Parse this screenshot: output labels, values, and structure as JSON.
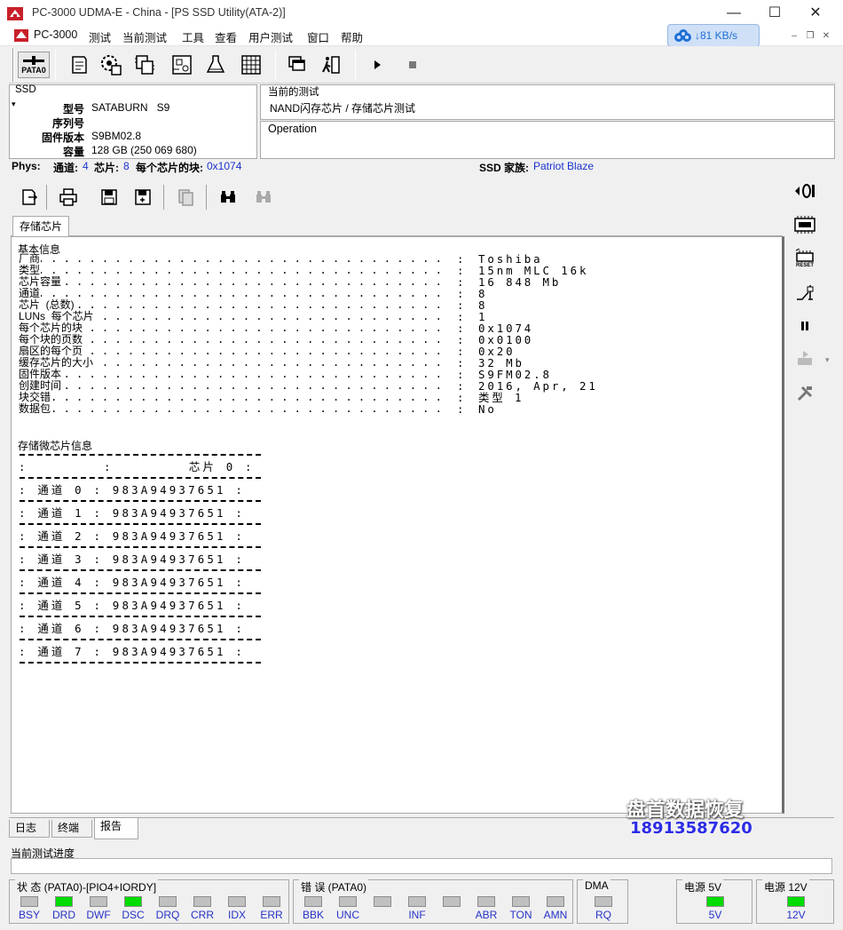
{
  "window": {
    "title": "PC-3000 UDMA-E - China - [PS SSD Utility(ATA-2)]"
  },
  "menu": [
    "PC-3000",
    "测试",
    "当前测试",
    "工具",
    "查看",
    "用户测试",
    "窗口",
    "帮助"
  ],
  "net_speed": "↓81 KB/s",
  "toolbar": {
    "pata_label": "PATA0"
  },
  "ssd_panel": {
    "title": "SSD",
    "model_label": "型号",
    "model_value": "SATABURN   S9",
    "serial_label": "序列号",
    "serial_value": "",
    "firmware_label": "固件版本",
    "firmware_value": "S9BM02.8",
    "capacity_label": "容量",
    "capacity_value": "128 GB (250 069 680)"
  },
  "current_test": {
    "title": "当前的测试",
    "value": "NAND闪存芯片 / 存储芯片测试"
  },
  "operation": {
    "title": "Operation"
  },
  "phys": {
    "label": "Phys:",
    "channel_label": "通道:",
    "channel_value": "4",
    "chips_label": "芯片:",
    "chips_value": "8",
    "blocks_label": "每个芯片的块:",
    "blocks_value": "0x1074",
    "family_label": "SSD 家族:",
    "family_value": "Patriot Blaze"
  },
  "report_tab": "存储芯片",
  "report": {
    "basic_title": "基本信息",
    "basic_rows": [
      {
        "label": "厂商",
        "value": "Toshiba"
      },
      {
        "label": "类型",
        "value": "15nm MLC 16k"
      },
      {
        "label": "芯片容量",
        "value": "16 848 Mb"
      },
      {
        "label": "通道",
        "value": "8"
      },
      {
        "label": "芯片  (总数)",
        "value": "8"
      },
      {
        "label": "LUNs  每个芯片",
        "value": "1"
      },
      {
        "label": "每个芯片的块",
        "value": "0x1074"
      },
      {
        "label": "每个块的页数",
        "value": "0x0100"
      },
      {
        "label": "扇区的每个页",
        "value": "0x20"
      },
      {
        "label": "缓存芯片的大小",
        "value": "32 Mb"
      },
      {
        "label": "固件版本",
        "value": "S9FM02.8"
      },
      {
        "label": "创建时间",
        "value": "2016, Apr, 21"
      },
      {
        "label": "块交错",
        "value": "类型 1"
      },
      {
        "label": "数据包",
        "value": "No"
      }
    ],
    "chip_title": "存储微芯片信息",
    "chip_header": ":        :        芯片 0 :",
    "chip_rows": [
      ": 通道 0 : 983A94937651 :",
      ": 通道 1 : 983A94937651 :",
      ": 通道 2 : 983A94937651 :",
      ": 通道 3 : 983A94937651 :",
      ": 通道 4 : 983A94937651 :",
      ": 通道 5 : 983A94937651 :",
      ": 通道 6 : 983A94937651 :",
      ": 通道 7 : 983A94937651 :"
    ]
  },
  "bottom_tabs": [
    "日志",
    "终端",
    "报告"
  ],
  "progress_label": "当前测试进度",
  "status": {
    "title": "状 态 (PATA0)-[PIO4+IORDY]",
    "leds": [
      {
        "label": "BSY",
        "on": false
      },
      {
        "label": "DRD",
        "on": true
      },
      {
        "label": "DWF",
        "on": false
      },
      {
        "label": "DSC",
        "on": true
      },
      {
        "label": "DRQ",
        "on": false
      },
      {
        "label": "CRR",
        "on": false
      },
      {
        "label": "IDX",
        "on": false
      },
      {
        "label": "ERR",
        "on": false
      }
    ]
  },
  "errors": {
    "title": "错 误 (PATA0)",
    "leds": [
      {
        "label": "BBK",
        "on": false
      },
      {
        "label": "UNC",
        "on": false
      },
      {
        "label": "",
        "on": false
      },
      {
        "label": "INF",
        "on": false
      },
      {
        "label": "",
        "on": false
      },
      {
        "label": "ABR",
        "on": false
      },
      {
        "label": "TON",
        "on": false
      },
      {
        "label": "AMN",
        "on": false
      }
    ]
  },
  "dma": {
    "title": "DMA",
    "label": "RQ"
  },
  "power5": {
    "title": "电源 5V",
    "label": "5V"
  },
  "power12": {
    "title": "电源 12V",
    "label": "12V"
  },
  "watermark": {
    "name": "盘首数据恢复",
    "phone": "18913587620"
  },
  "colors": {
    "led_on": "#00dc00",
    "led_label": "#2532c8",
    "value_blue": "#1a32d0"
  }
}
